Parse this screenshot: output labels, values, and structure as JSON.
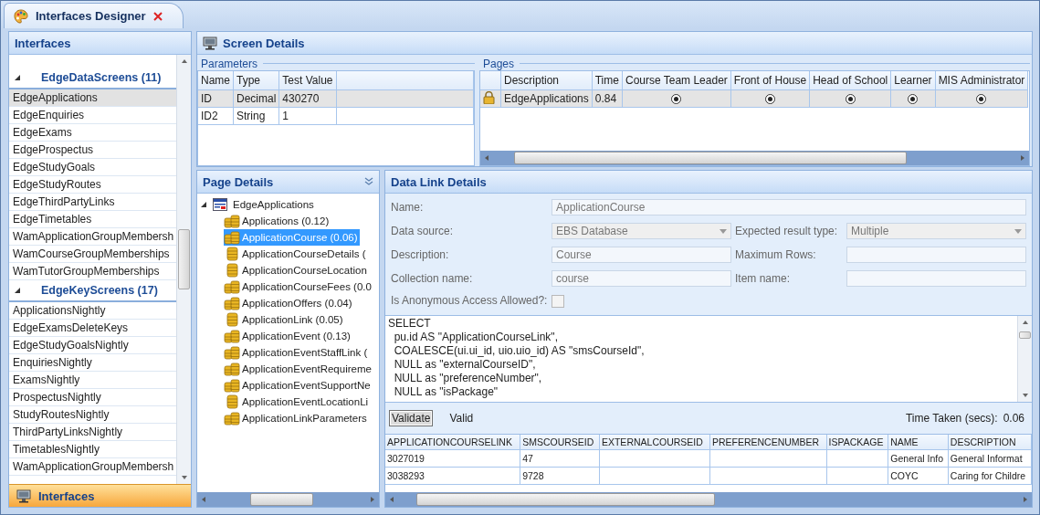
{
  "tab": {
    "title": "Interfaces Designer"
  },
  "interfaces": {
    "title": "Interfaces",
    "groups": [
      {
        "title": "EdgeDataScreens (11)",
        "expanded": true,
        "items": [
          {
            "label": "EdgeApplications",
            "selected": true
          },
          {
            "label": "EdgeEnquiries",
            "selected": false
          },
          {
            "label": "EdgeExams",
            "selected": false
          },
          {
            "label": "EdgeProspectus",
            "selected": false
          },
          {
            "label": "EdgeStudyGoals",
            "selected": false
          },
          {
            "label": "EdgeStudyRoutes",
            "selected": false
          },
          {
            "label": "EdgeThirdPartyLinks",
            "selected": false
          },
          {
            "label": "EdgeTimetables",
            "selected": false
          },
          {
            "label": "WamApplicationGroupMembersh",
            "selected": false
          },
          {
            "label": "WamCourseGroupMemberships",
            "selected": false
          },
          {
            "label": "WamTutorGroupMemberships",
            "selected": false
          }
        ]
      },
      {
        "title": "EdgeKeyScreens (17)",
        "expanded": true,
        "items": [
          {
            "label": "ApplicationsNightly",
            "selected": false
          },
          {
            "label": "EdgeExamsDeleteKeys",
            "selected": false
          },
          {
            "label": "EdgeStudyGoalsNightly",
            "selected": false
          },
          {
            "label": "EnquiriesNightly",
            "selected": false
          },
          {
            "label": "ExamsNightly",
            "selected": false
          },
          {
            "label": "ProspectusNightly",
            "selected": false
          },
          {
            "label": "StudyRoutesNightly",
            "selected": false
          },
          {
            "label": "ThirdPartyLinksNightly",
            "selected": false
          },
          {
            "label": "TimetablesNightly",
            "selected": false
          },
          {
            "label": "WamApplicationGroupMembersh",
            "selected": false
          }
        ]
      }
    ],
    "footer": "Interfaces"
  },
  "screen_details": {
    "title": "Screen Details",
    "parameters": {
      "title": "Parameters",
      "columns": [
        "Name",
        "Type",
        "Test Value"
      ],
      "rows": [
        {
          "cells": [
            "ID",
            "Decimal",
            "430270"
          ],
          "selected": true
        },
        {
          "cells": [
            "ID2",
            "String",
            "1"
          ],
          "selected": false
        }
      ]
    },
    "pages": {
      "title": "Pages",
      "columns": [
        "Description",
        "Time",
        "Course Team Leader",
        "Front of House",
        "Head of School",
        "Learner",
        "MIS Administrator"
      ],
      "rows": [
        {
          "locked": true,
          "selected": true,
          "description": "EdgeApplications",
          "time": "0.84",
          "roles": [
            {
              "selected": true
            },
            {
              "selected": true
            },
            {
              "selected": true
            },
            {
              "selected": true
            },
            {
              "selected": true
            }
          ]
        }
      ]
    }
  },
  "page_details": {
    "title": "Page Details",
    "tree": {
      "label": "EdgeApplications",
      "expanded": true,
      "children": [
        {
          "label": "Applications (0.12)",
          "kind": "stacks",
          "selected": false
        },
        {
          "label": "ApplicationCourse (0.06)",
          "kind": "stacks",
          "selected": true
        },
        {
          "label": "ApplicationCourseDetails (",
          "kind": "cylinder",
          "selected": false
        },
        {
          "label": "ApplicationCourseLocation",
          "kind": "cylinder",
          "selected": false
        },
        {
          "label": "ApplicationCourseFees (0.0",
          "kind": "stacks",
          "selected": false
        },
        {
          "label": "ApplicationOffers (0.04)",
          "kind": "stacks",
          "selected": false
        },
        {
          "label": "ApplicationLink (0.05)",
          "kind": "cylinder",
          "selected": false
        },
        {
          "label": "ApplicationEvent (0.13)",
          "kind": "stacks",
          "selected": false
        },
        {
          "label": "ApplicationEventStaffLink (",
          "kind": "stacks",
          "selected": false
        },
        {
          "label": "ApplicationEventRequireme",
          "kind": "stacks",
          "selected": false
        },
        {
          "label": "ApplicationEventSupportNe",
          "kind": "stacks",
          "selected": false
        },
        {
          "label": "ApplicationEventLocationLi",
          "kind": "cylinder",
          "selected": false
        },
        {
          "label": "ApplicationLinkParameters",
          "kind": "stacks",
          "selected": false
        }
      ]
    }
  },
  "data_link": {
    "title": "Data Link Details",
    "fields": [
      {
        "label": "Name:",
        "kind": "text",
        "value": "ApplicationCourse",
        "full_width": true
      },
      {
        "label": "Data source:",
        "kind": "select",
        "value": "EBS Database"
      },
      {
        "label": "Expected result type:",
        "kind": "select",
        "value": "Multiple"
      },
      {
        "label": "Description:",
        "kind": "text",
        "value": "Course"
      },
      {
        "label": "Maximum Rows:",
        "kind": "text"
      },
      {
        "label": "Collection name:",
        "kind": "text",
        "value": "course"
      },
      {
        "label": "Item name:",
        "kind": "text"
      },
      {
        "label": "Is Anonymous Access Allowed?:",
        "kind": "checkbox",
        "checked": false
      }
    ],
    "query": [
      "SELECT",
      "  pu.id AS \"ApplicationCourseLink\",",
      "  COALESCE(ui.ui_id, uio.uio_id) AS \"smsCourseId\",",
      "  NULL as \"externalCourseID\",",
      "  NULL as \"preferenceNumber\",",
      "  NULL as \"isPackage\""
    ],
    "validate_button": "Validate",
    "status": "Valid",
    "time_label": "Time Taken (secs):",
    "time_value": "0.06",
    "results": {
      "columns": [
        "APPLICATIONCOURSELINK",
        "SMSCOURSEID",
        "EXTERNALCOURSEID",
        "PREFERENCENUMBER",
        "ISPACKAGE",
        "NAME",
        "DESCRIPTION"
      ],
      "rows": [
        [
          "3027019",
          "47",
          "",
          "",
          "",
          "General Info",
          "General Informat"
        ],
        [
          "3038293",
          "9728",
          "",
          "",
          "",
          "COYC",
          "Caring for Childre"
        ]
      ]
    }
  }
}
